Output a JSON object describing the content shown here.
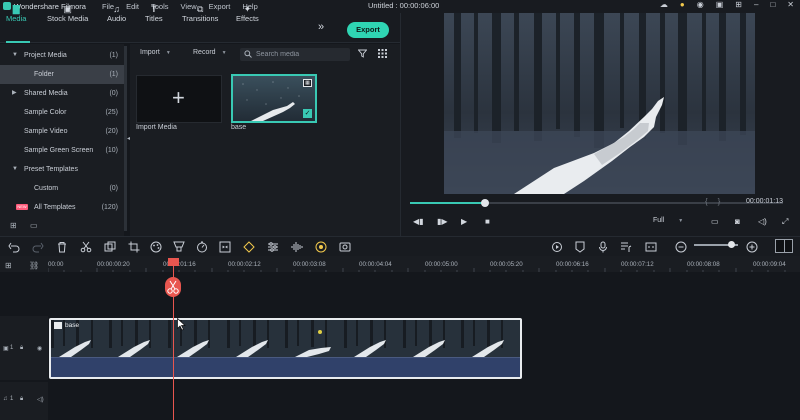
{
  "titlebar": {
    "app_name": "Wondershare Filmora",
    "menu": [
      "File",
      "Edit",
      "Tools",
      "View",
      "Export",
      "Help"
    ],
    "document_title": "Untitled : 00:00:06:00"
  },
  "toolbar": {
    "tabs": [
      "Media",
      "Stock Media",
      "Audio",
      "Titles",
      "Transitions",
      "Effects"
    ],
    "active_tab": "Media",
    "export_label": "Export"
  },
  "sidebar": {
    "items": [
      {
        "label": "Project Media",
        "count": "(1)"
      },
      {
        "label": "Folder",
        "count": "(1)"
      },
      {
        "label": "Shared Media",
        "count": "(0)"
      },
      {
        "label": "Sample Color",
        "count": "(25)"
      },
      {
        "label": "Sample Video",
        "count": "(20)"
      },
      {
        "label": "Sample Green Screen",
        "count": "(10)"
      },
      {
        "label": "Preset Templates",
        "count": ""
      },
      {
        "label": "Custom",
        "count": "(0)"
      },
      {
        "label": "All Templates",
        "count": "(120)"
      }
    ],
    "new_badge": "NEW"
  },
  "media": {
    "import_dropdown": "Import",
    "record_dropdown": "Record",
    "search_placeholder": "Search media",
    "import_tile_label": "Import Media",
    "clip_tile_label": "base"
  },
  "preview": {
    "timecode": "00:00:01:13",
    "quality": "Full",
    "progress": 0.2
  },
  "timeline": {
    "ruler_labels": [
      "00:00",
      "00:00:00:20",
      "00:00:01:16",
      "00:00:02:12",
      "00:00:03:08",
      "00:00:04:04",
      "00:00:05:00",
      "00:00:05:20",
      "00:00:06:16",
      "00:00:07:12",
      "00:00:08:08",
      "00:00:09:04"
    ],
    "video_track_label": "1",
    "audio_track_label": "1",
    "clip_name": "base"
  },
  "colors": {
    "accent": "#39c9b4",
    "export_button": "#2fd5b3",
    "playhead": "#e8564f"
  }
}
